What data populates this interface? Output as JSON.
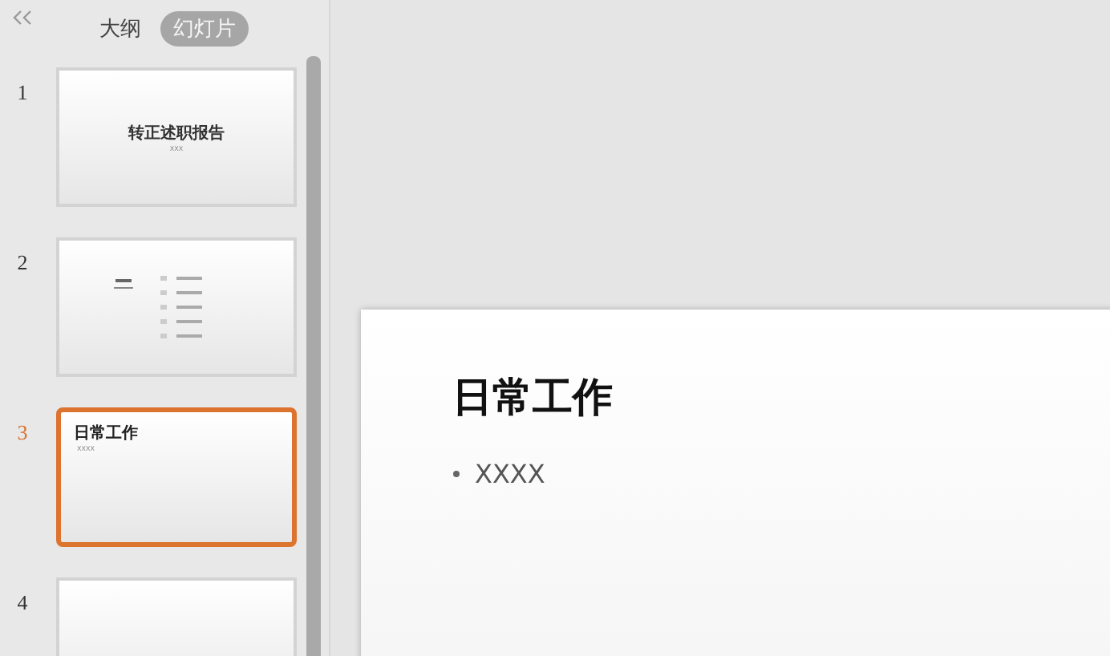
{
  "panel": {
    "tabs": [
      {
        "label": "大纲",
        "selected": false
      },
      {
        "label": "幻灯片",
        "selected": true
      }
    ],
    "slides": [
      {
        "number": "1",
        "selected": false,
        "kind": "title",
        "title": "转正述职报告",
        "subtitle": "XXX"
      },
      {
        "number": "2",
        "selected": false,
        "kind": "contents"
      },
      {
        "number": "3",
        "selected": true,
        "kind": "content",
        "title": "日常工作",
        "bullets": [
          "XXXX"
        ]
      },
      {
        "number": "4",
        "selected": false,
        "kind": "blank"
      }
    ]
  },
  "slide": {
    "title": "日常工作",
    "bullets": [
      "XXXX"
    ]
  }
}
